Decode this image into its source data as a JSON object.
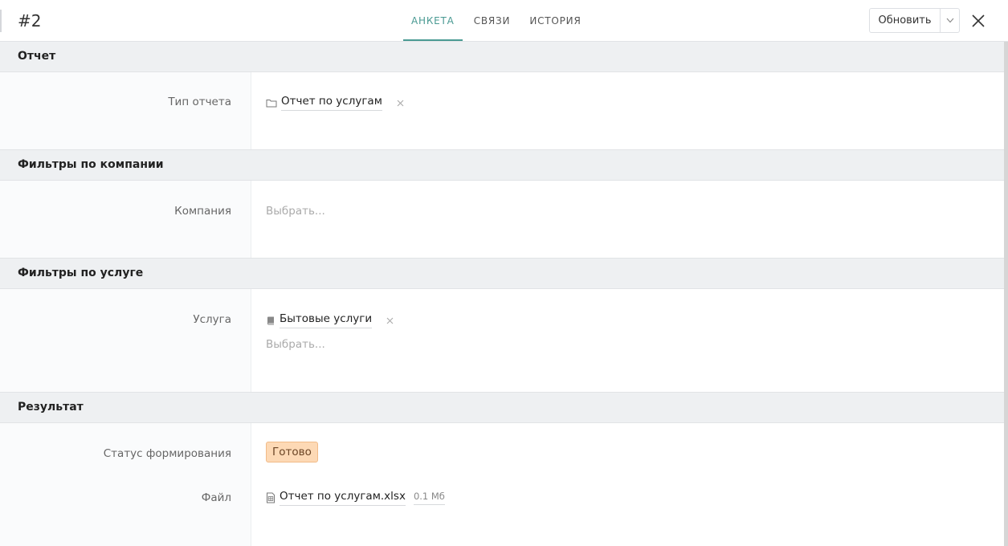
{
  "header": {
    "record_id": "#2",
    "tabs": [
      {
        "label": "АНКЕТА",
        "active": true
      },
      {
        "label": "СВЯЗИ",
        "active": false
      },
      {
        "label": "ИСТОРИЯ",
        "active": false
      }
    ],
    "update_label": "Обновить",
    "accent_color": "#4a9a93"
  },
  "sections": {
    "report": {
      "title": "Отчет",
      "report_type_label": "Тип отчета",
      "report_type_value": "Отчет по услугам"
    },
    "company_filters": {
      "title": "Фильтры по компании",
      "company_label": "Компания",
      "company_placeholder": "Выбрать..."
    },
    "service_filters": {
      "title": "Фильтры по услуге",
      "service_label": "Услуга",
      "service_value": "Бытовые услуги",
      "service_placeholder": "Выбрать..."
    },
    "result": {
      "title": "Результат",
      "status_label": "Статус формирования",
      "status_value": "Готово",
      "status_color": "#fdd9b5",
      "file_label": "Файл",
      "file_name": "Отчет по услугам.xlsx",
      "file_size": "0.1 Мб"
    }
  }
}
